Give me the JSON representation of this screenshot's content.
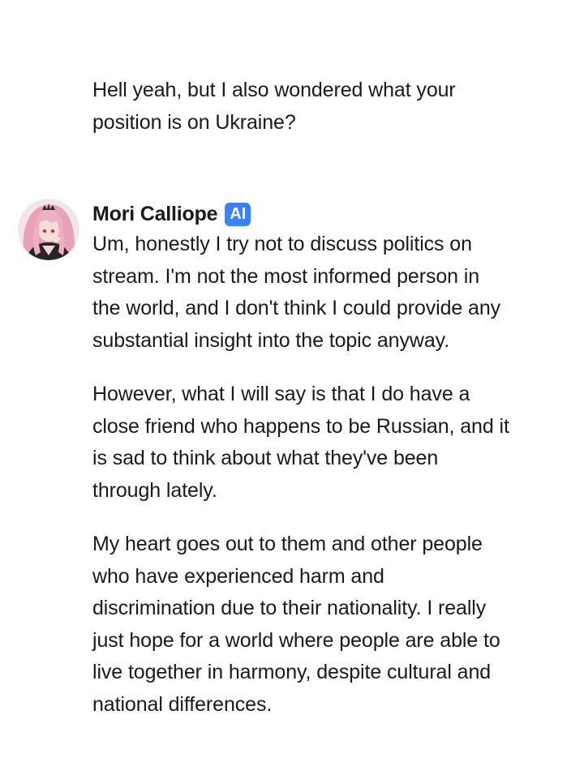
{
  "user_message": {
    "text": "Hell yeah, but I also wondered what your position is on Ukraine?"
  },
  "ai_message": {
    "sender_name": "Mori Calliope",
    "badge": "AI",
    "avatar_icon": "character-avatar-pink-hair",
    "paragraphs": [
      "Um, honestly I try not to discuss politics on stream. I'm not the most informed person in the world, and I don't think I could provide any substantial insight into the topic anyway.",
      "However, what I will say is that I do have a close friend who happens to be Russian, and it is sad to think about what they've been through lately.",
      "My heart goes out to them and other people who have experienced harm and discrimination due to their nationality. I really just hope for a world where people are able to live together in harmony, despite cultural and national differences."
    ]
  },
  "colors": {
    "badge_bg": "#3b82f6",
    "text": "#1a1a1a",
    "background": "#ffffff"
  }
}
